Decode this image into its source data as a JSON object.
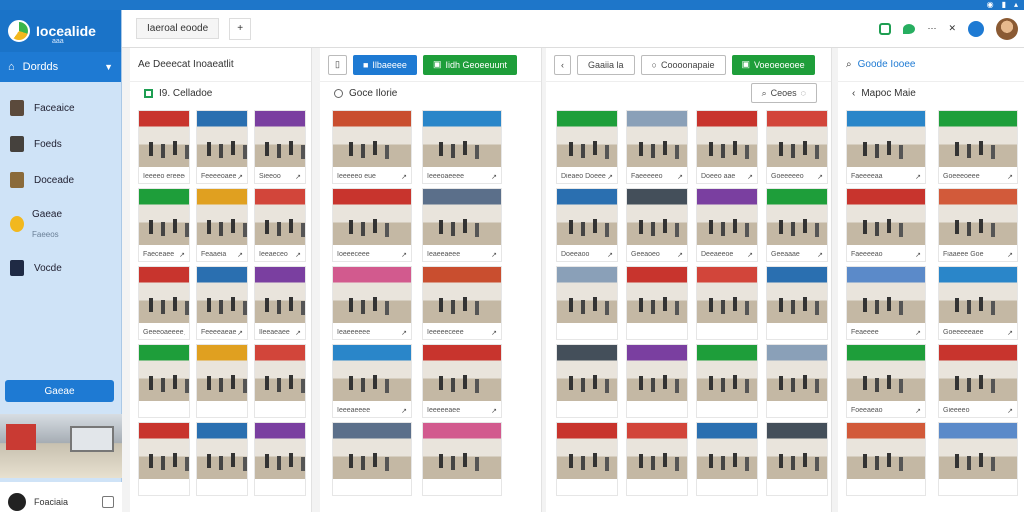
{
  "system": {
    "icons": [
      "wifi-icon",
      "battery-icon",
      "signal-icon"
    ]
  },
  "sidebar": {
    "logo_text": "Iocealide",
    "logo_sub": "aaa",
    "header": "Dordds",
    "items": [
      {
        "label": "Faceaice"
      },
      {
        "label": "Foeds"
      },
      {
        "label": "Doceade"
      },
      {
        "label": "Gaeae",
        "sublabel": "Faeeos"
      },
      {
        "label": "Vocde"
      }
    ],
    "button": "Gaeae",
    "user": "Foaciaia"
  },
  "topbar": {
    "tab": "Iaeroal eoode",
    "add": "+"
  },
  "colors": {
    "accent": "#1e7ad3",
    "green": "#1e9e3a",
    "sidebar_bg": "#cfe3f7"
  },
  "panel1": {
    "title": "Ae Deeecat Inoaeatlit",
    "subtitle": "I9. Celladoe",
    "captions": [
      "Ieeeeo ereeee",
      "Feeeeoaee",
      "Sieeoo",
      "Faeceaee",
      "Feaaeia",
      "Ieeaeceo",
      "Geeeoaeeee",
      "Feeeeaeae",
      "Ileeaeaee"
    ]
  },
  "panel2": {
    "title": "Goce Ilorie",
    "btn_blue": "Ilbaeeee",
    "btn_green": "Iidh Geoeeuunt",
    "captions": [
      "Ieeeeeo eue",
      "Ieeeoaeeee",
      "Ioeeeceee",
      "Ieaeeaeee",
      "Ieaeeeeee",
      "Ieeeeeceee",
      "Ieeeaeeee",
      "Ieeeeeaee"
    ]
  },
  "panel3": {
    "btn_1": "Gaaiia la",
    "btn_2": "Coooonapaie",
    "btn_green": "Voeoeoeoee",
    "search": "Ceoes",
    "captions": [
      "Dieaeo Doeee",
      "Faeeeeeo",
      "Doeeo aae",
      "Goeeeeeo",
      "Doeeaoo",
      "Geeaoeo",
      "Deeaeeoe",
      "Geeaaae"
    ]
  },
  "panel4": {
    "top_label": "Goode Iooee",
    "title": "Mapoc Maie",
    "captions": [
      "Faeeeeaa",
      "Goeeeoeee",
      "Faeeeeao",
      "Fiaaeee Goe",
      "Feaeeee",
      "Goeeeeeaee",
      "Foeeaeao",
      "Gieeeeo"
    ]
  }
}
